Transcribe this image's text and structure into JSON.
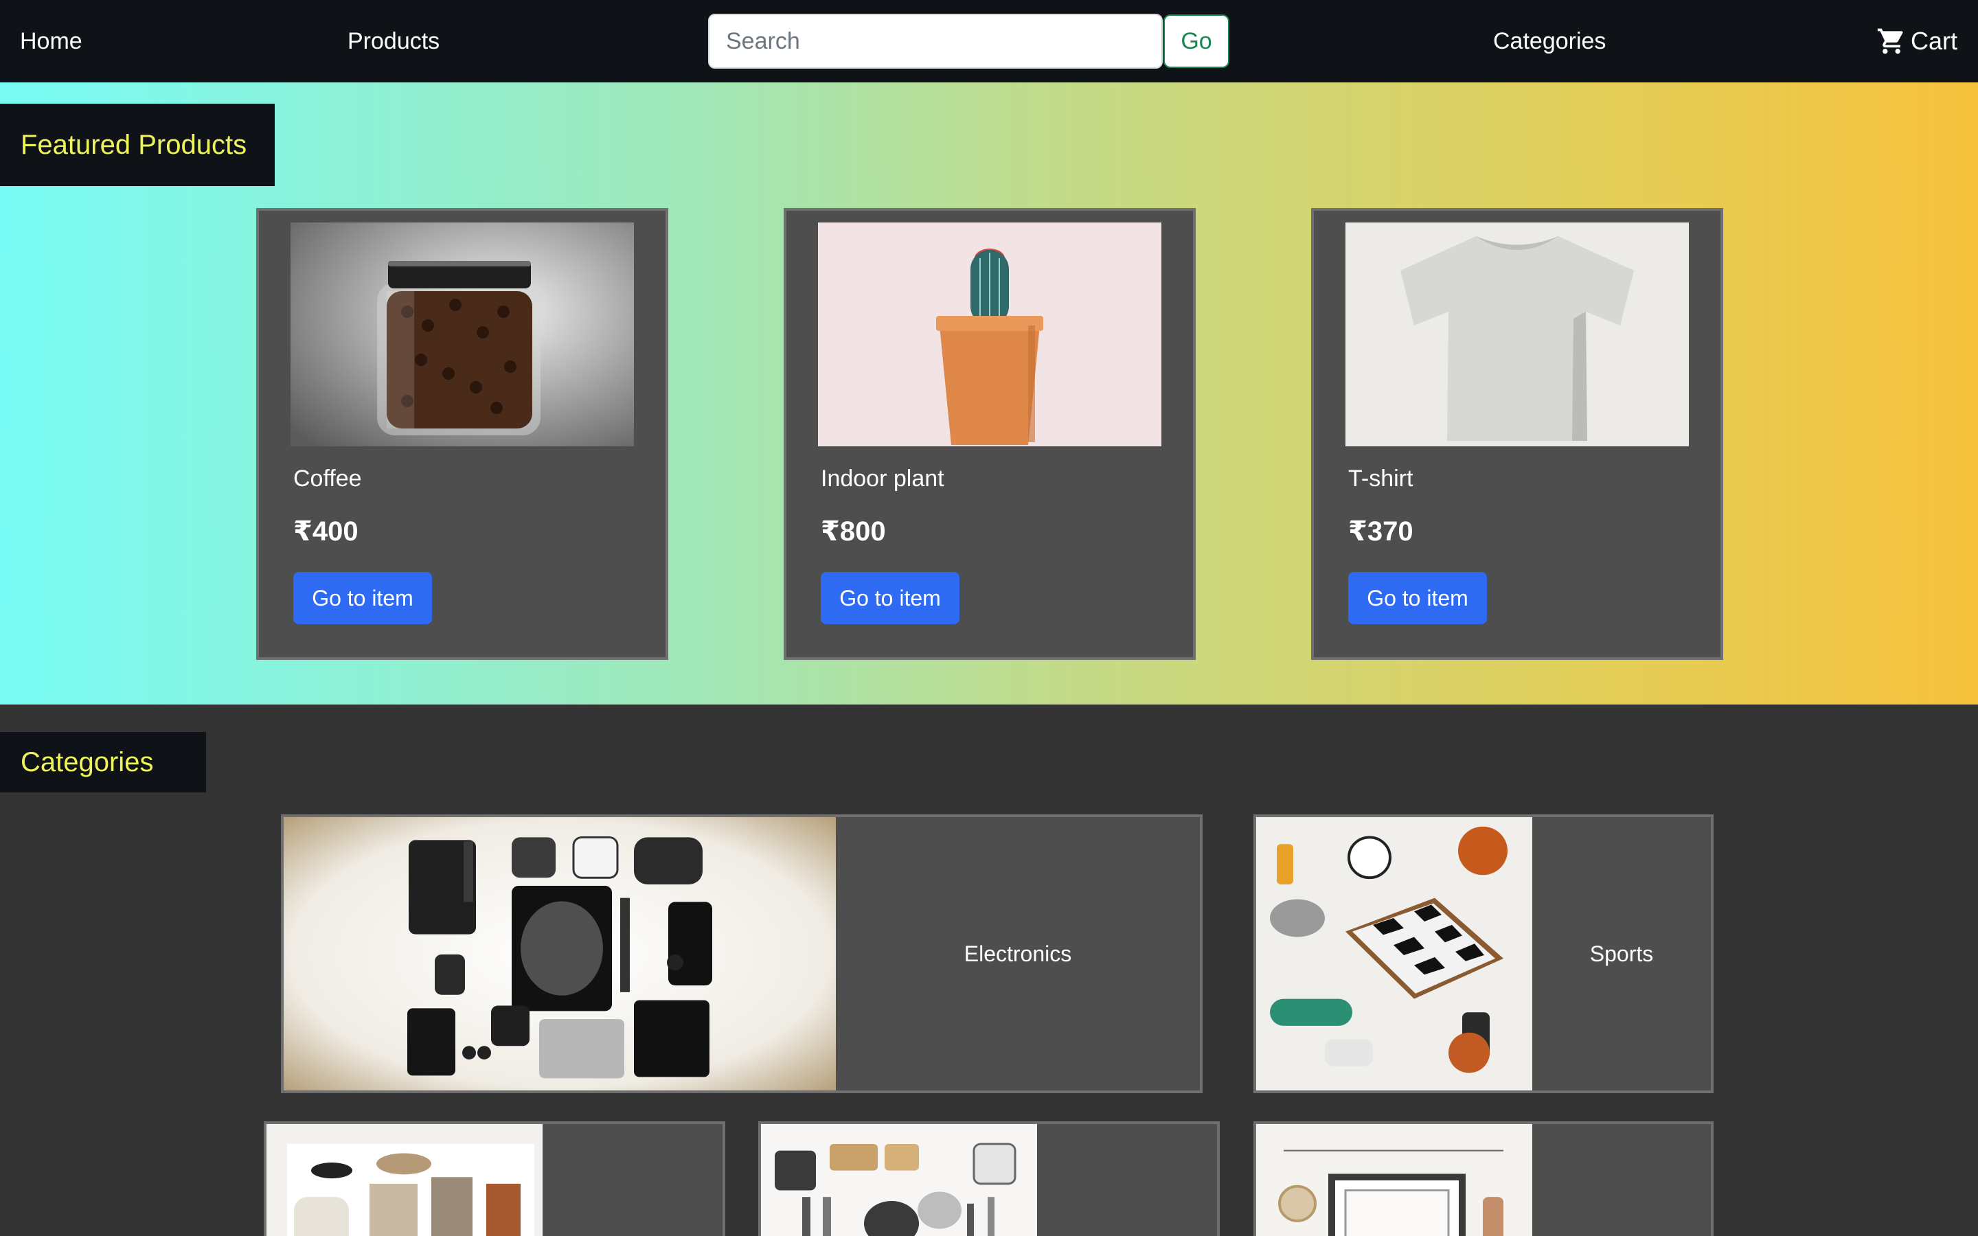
{
  "navbar": {
    "home": "Home",
    "products": "Products",
    "search_placeholder": "Search",
    "go": "Go",
    "categories": "Categories",
    "cart": "Cart"
  },
  "featured": {
    "heading": "Featured Products",
    "products": [
      {
        "name": "Coffee",
        "price": "₹400",
        "button": "Go to item",
        "image": "coffee-jar-image"
      },
      {
        "name": "Indoor plant",
        "price": "₹800",
        "button": "Go to item",
        "image": "cactus-pot-image"
      },
      {
        "name": "T-shirt",
        "price": "₹370",
        "button": "Go to item",
        "image": "tshirt-image"
      }
    ]
  },
  "categories": {
    "heading": "Categories",
    "items": [
      {
        "label": "Electronics",
        "image": "electronics-flatlay-image"
      },
      {
        "label": "Sports",
        "image": "sports-flatlay-image"
      },
      {
        "label": "",
        "image": "fashion-image"
      },
      {
        "label": "",
        "image": "kitchen-image"
      },
      {
        "label": "",
        "image": "home-decor-image"
      }
    ]
  },
  "colors": {
    "navbar_bg": "#0f1318",
    "heading_text": "#eef45a",
    "button_blue": "#2f6bf2",
    "go_green": "#198754",
    "card_bg": "#4e4e4e",
    "page_bg": "#333333"
  }
}
